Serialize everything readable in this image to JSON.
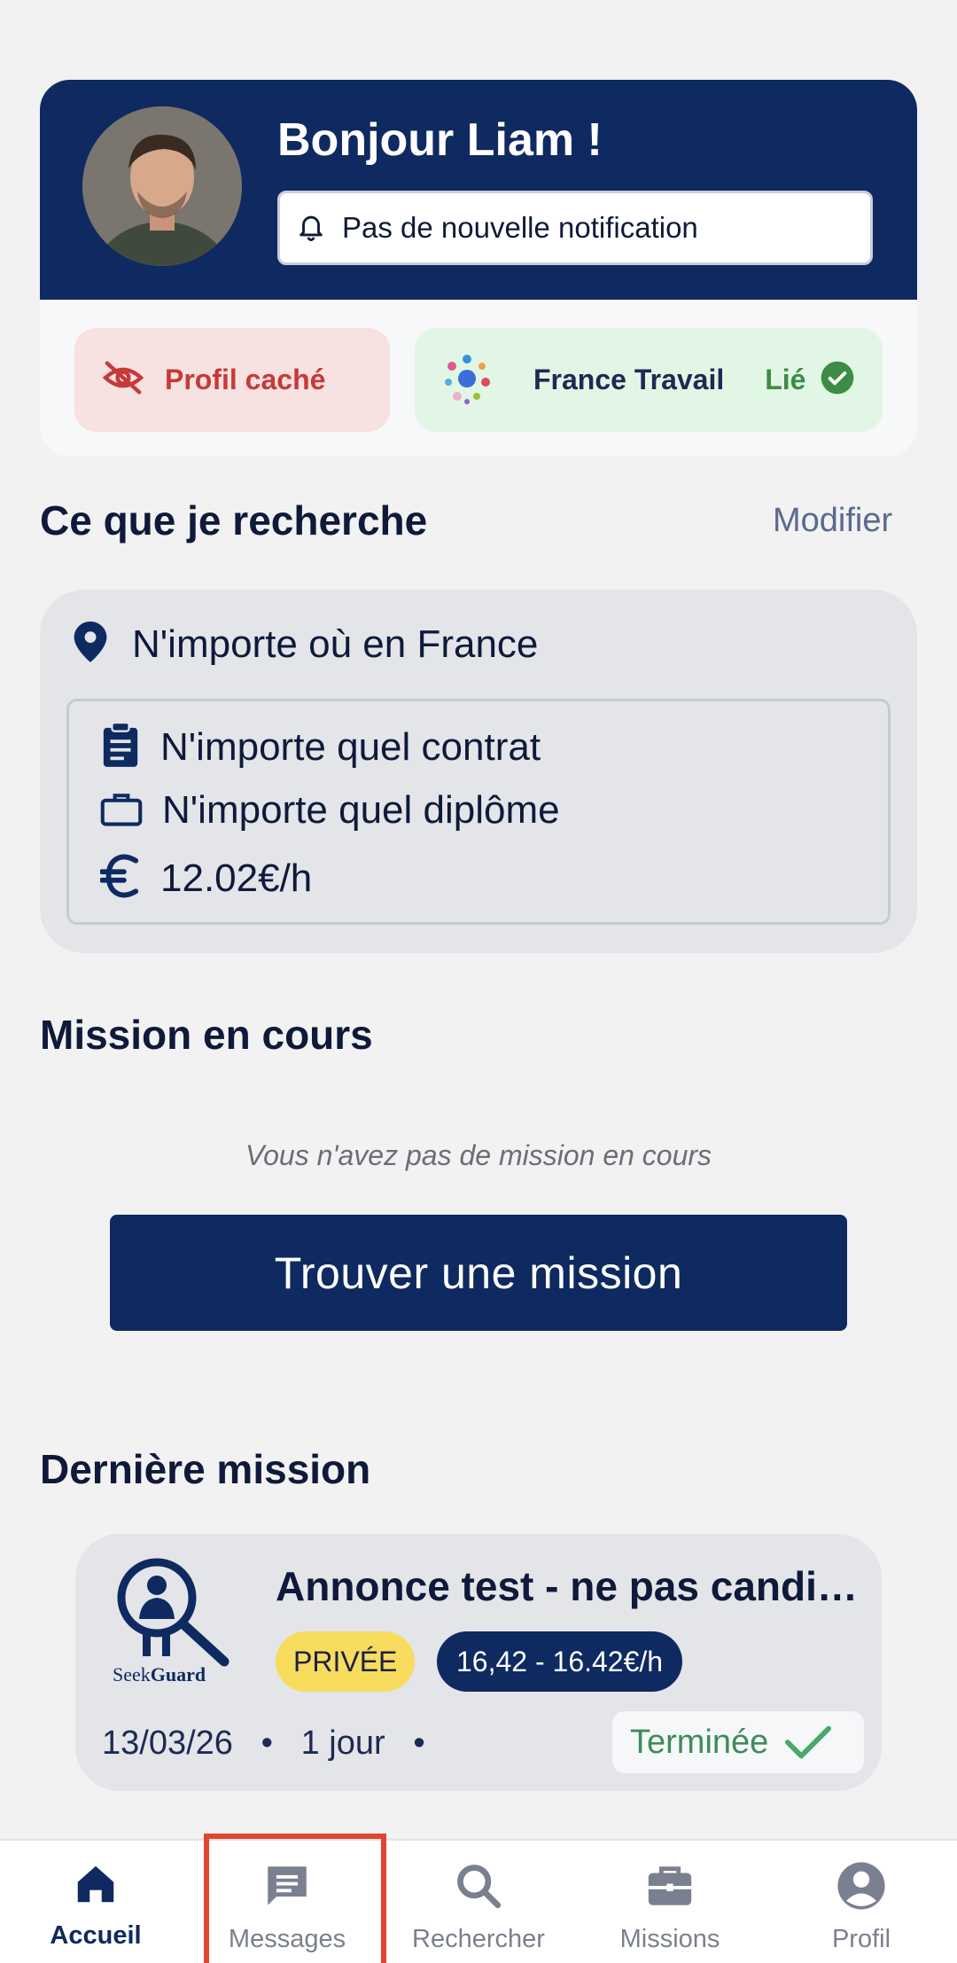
{
  "header": {
    "greeting": "Bonjour Liam !",
    "notification": "Pas de nouvelle notification",
    "profile_status": "Profil caché",
    "partner_name": "France Travail",
    "partner_status": "Lié"
  },
  "search": {
    "title": "Ce que je recherche",
    "edit_label": "Modifier",
    "location": "N'importe où en France",
    "contract": "N'importe quel contrat",
    "diploma": "N'importe quel diplôme",
    "rate": "12.02€/h"
  },
  "current_mission": {
    "title": "Mission en cours",
    "empty_text": "Vous n'avez pas de mission en cours",
    "button_label": "Trouver une mission"
  },
  "last_mission": {
    "section_title": "Dernière mission",
    "title": "Annonce test - ne pas candid…",
    "company_logo_text": "SeekGuard",
    "badge_type": "PRIVÉE",
    "badge_rate": "16,42 - 16.42€/h",
    "date": "13/03/26",
    "duration": "1 jour",
    "status": "Terminée"
  },
  "bottom_nav": {
    "items": [
      {
        "label": "Accueil",
        "icon": "home-icon",
        "active": true
      },
      {
        "label": "Messages",
        "icon": "message-icon",
        "active": false
      },
      {
        "label": "Rechercher",
        "icon": "search-icon",
        "active": false
      },
      {
        "label": "Missions",
        "icon": "briefcase-icon",
        "active": false
      },
      {
        "label": "Profil",
        "icon": "profile-icon",
        "active": false
      }
    ]
  },
  "colors": {
    "navy": "#0f2a60",
    "background": "#f2f2f2",
    "hidden_red": "#c63a3a",
    "linked_green": "#3d8c46",
    "private_yellow": "#f7dc5e",
    "highlight_red": "#e0452f"
  }
}
